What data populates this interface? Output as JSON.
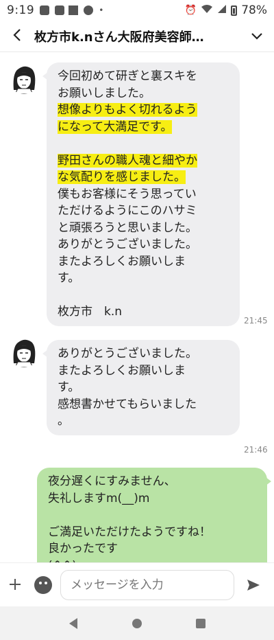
{
  "status": {
    "time": "9:19",
    "battery": "78%"
  },
  "header": {
    "title": "枚方市k.nさん大阪府美容師…"
  },
  "messages": [
    {
      "from": "other",
      "lines": [
        {
          "text": "今回初めて研ぎと裏スキを",
          "highlight": false
        },
        {
          "text": "お願いしました。",
          "highlight": false
        },
        {
          "text": "想像よりもよく切れるよう",
          "highlight": true
        },
        {
          "text": "になって大満足です。",
          "highlight": true
        },
        {
          "text": "",
          "highlight": false
        },
        {
          "text": "野田さんの職人魂と細やか",
          "highlight": true
        },
        {
          "text": "な気配りを感じました。",
          "highlight": true
        },
        {
          "text": "僕もお客様にそう思ってい",
          "highlight": false
        },
        {
          "text": "ただけるようにこのハサミ",
          "highlight": false
        },
        {
          "text": "と頑張ろうと思いました。",
          "highlight": false
        },
        {
          "text": "ありがとうございました。",
          "highlight": false
        },
        {
          "text": "またよろしくお願いしま",
          "highlight": false
        },
        {
          "text": "す。",
          "highlight": false
        },
        {
          "text": "",
          "highlight": false
        },
        {
          "text": "枚方市　k.n",
          "highlight": false
        }
      ],
      "time": "21:45"
    },
    {
      "from": "other",
      "lines": [
        {
          "text": "ありがとうございました。",
          "highlight": false
        },
        {
          "text": "またよろしくお願いしま",
          "highlight": false
        },
        {
          "text": "す。",
          "highlight": false
        },
        {
          "text": "感想書かせてもらいました",
          "highlight": false
        },
        {
          "text": "。",
          "highlight": false
        }
      ],
      "time": "21:46"
    },
    {
      "from": "me",
      "lines": [
        {
          "text": "夜分遅くにすみません、",
          "highlight": false
        },
        {
          "text": "失礼しますm(__)m",
          "highlight": false
        },
        {
          "text": "",
          "highlight": false
        },
        {
          "text": "ご満足いただけたようですね！",
          "highlight": false
        },
        {
          "text": "良かったです",
          "highlight": false
        },
        {
          "text": "(^^)",
          "highlight": false
        }
      ]
    }
  ],
  "input": {
    "placeholder": "メッセージを入力"
  },
  "colors": {
    "highlight": "#f7ee13",
    "bubble_other": "#eeeef0",
    "bubble_me": "#b9e3a5"
  },
  "icons": [
    "back-arrow-icon",
    "chevron-down-icon",
    "plus-icon",
    "emoji-icon",
    "send-icon",
    "nav-back-icon",
    "nav-home-icon",
    "nav-recents-icon"
  ]
}
